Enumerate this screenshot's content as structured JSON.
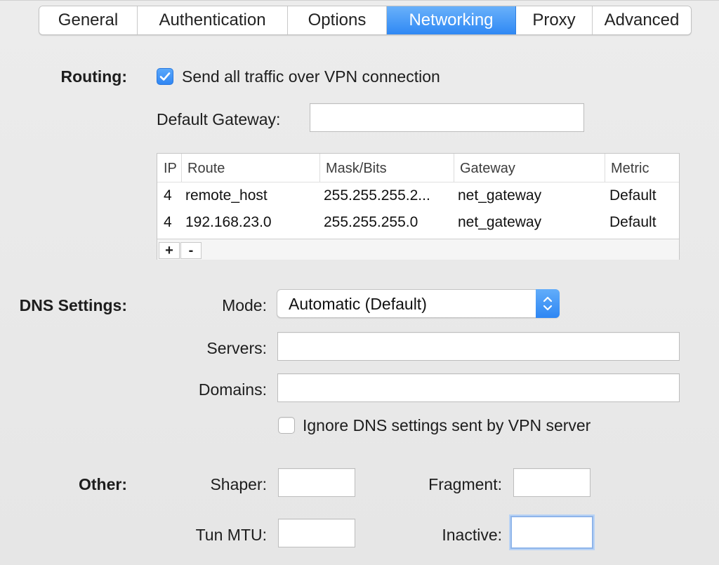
{
  "tabs": [
    {
      "label": "General",
      "active": false
    },
    {
      "label": "Authentication",
      "active": false
    },
    {
      "label": "Options",
      "active": false
    },
    {
      "label": "Networking",
      "active": true
    },
    {
      "label": "Proxy",
      "active": false
    },
    {
      "label": "Advanced",
      "active": false
    }
  ],
  "routing": {
    "section_label": "Routing:",
    "send_all_label": "Send all traffic over VPN connection",
    "send_all_checked": true,
    "gateway_label": "Default Gateway:",
    "gateway_value": ""
  },
  "routes_table": {
    "columns": [
      "IP",
      "Route",
      "Mask/Bits",
      "Gateway",
      "Metric"
    ],
    "rows": [
      {
        "ip": "4",
        "route": "remote_host",
        "mask": "255.255.255.2...",
        "gateway": "net_gateway",
        "metric": "Default"
      },
      {
        "ip": "4",
        "route": "192.168.23.0",
        "mask": "255.255.255.0",
        "gateway": "net_gateway",
        "metric": "Default"
      }
    ],
    "add_label": "+",
    "remove_label": "-"
  },
  "dns": {
    "section_label": "DNS Settings:",
    "mode_label": "Mode:",
    "mode_value": "Automatic (Default)",
    "servers_label": "Servers:",
    "servers_value": "",
    "domains_label": "Domains:",
    "domains_value": "",
    "ignore_label": "Ignore DNS settings sent by VPN server",
    "ignore_checked": false
  },
  "other": {
    "section_label": "Other:",
    "shaper_label": "Shaper:",
    "shaper_value": "",
    "fragment_label": "Fragment:",
    "fragment_value": "",
    "tun_mtu_label": "Tun MTU:",
    "tun_mtu_value": "",
    "inactive_label": "Inactive:",
    "inactive_value": ""
  },
  "colors": {
    "accent": "#2f88f4",
    "window_bg": "#ececec"
  },
  "icons": {
    "checkmark": "checkmark-icon",
    "updown": "chevron-updown-icon"
  }
}
